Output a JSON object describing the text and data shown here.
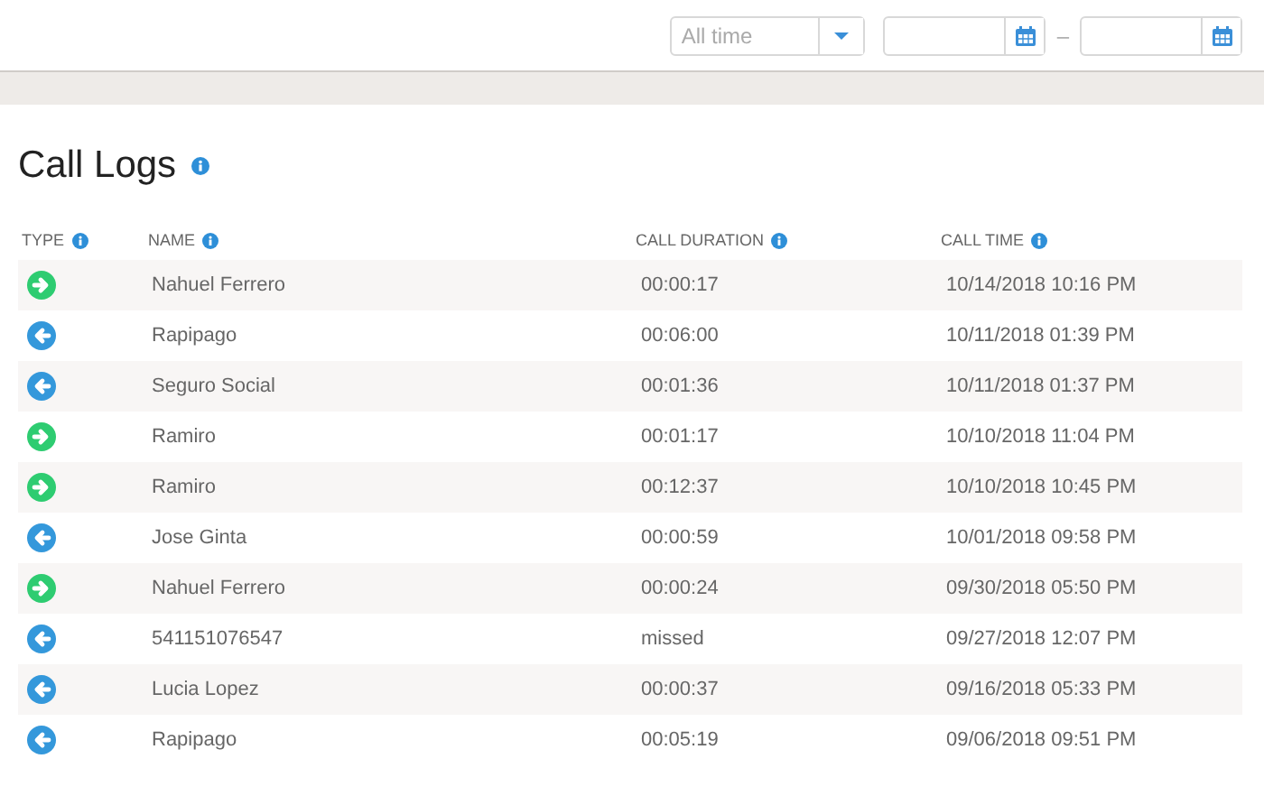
{
  "filters": {
    "range": {
      "value": "All time"
    },
    "separator": "–"
  },
  "title": "Call Logs",
  "table": {
    "columns": [
      "TYPE",
      "NAME",
      "CALL DURATION",
      "CALL TIME"
    ],
    "rows": [
      {
        "kind": "outgoing",
        "name": "Nahuel Ferrero",
        "duration": "00:00:17",
        "time": "10/14/2018 10:16 PM"
      },
      {
        "kind": "incoming",
        "name": "Rapipago",
        "duration": "00:06:00",
        "time": "10/11/2018 01:39 PM"
      },
      {
        "kind": "incoming",
        "name": "Seguro Social",
        "duration": "00:01:36",
        "time": "10/11/2018 01:37 PM"
      },
      {
        "kind": "outgoing",
        "name": "Ramiro",
        "duration": "00:01:17",
        "time": "10/10/2018 11:04 PM"
      },
      {
        "kind": "outgoing",
        "name": "Ramiro",
        "duration": "00:12:37",
        "time": "10/10/2018 10:45 PM"
      },
      {
        "kind": "incoming",
        "name": "Jose Ginta",
        "duration": "00:00:59",
        "time": "10/01/2018 09:58 PM"
      },
      {
        "kind": "outgoing",
        "name": "Nahuel Ferrero",
        "duration": "00:00:24",
        "time": "09/30/2018 05:50 PM"
      },
      {
        "kind": "incoming",
        "name": "541151076547",
        "duration": "missed",
        "time": "09/27/2018 12:07 PM"
      },
      {
        "kind": "incoming",
        "name": "Lucia Lopez",
        "duration": "00:00:37",
        "time": "09/16/2018 05:33 PM"
      },
      {
        "kind": "incoming",
        "name": "Rapipago",
        "duration": "00:05:19",
        "time": "09/06/2018 09:51 PM"
      }
    ]
  }
}
